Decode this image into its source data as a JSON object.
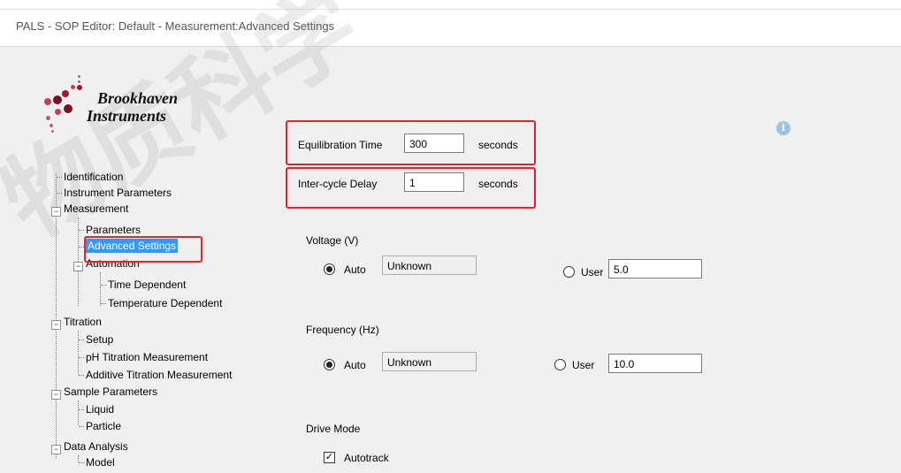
{
  "window": {
    "title": "PALS - SOP Editor: Default - Measurement:Advanced Settings"
  },
  "logo": {
    "line1": "Brookhaven",
    "line2": "Instruments"
  },
  "watermark": "物质科学",
  "tree": {
    "items": [
      {
        "label": "Identification"
      },
      {
        "label": "Instrument Parameters"
      },
      {
        "label": "Measurement",
        "expander": "−"
      },
      {
        "label": "Parameters"
      },
      {
        "label": "Advanced Settings"
      },
      {
        "label": "Automation",
        "expander": "−"
      },
      {
        "label": "Time Dependent"
      },
      {
        "label": "Temperature Dependent"
      },
      {
        "label": "Titration",
        "expander": "−"
      },
      {
        "label": "Setup"
      },
      {
        "label": "pH Titration Measurement"
      },
      {
        "label": "Additive Titration Measurement"
      },
      {
        "label": "Sample Parameters",
        "expander": "−"
      },
      {
        "label": "Liquid"
      },
      {
        "label": "Particle"
      },
      {
        "label": "Data Analysis",
        "expander": "−"
      },
      {
        "label": "Model"
      }
    ],
    "selected": "Advanced Settings"
  },
  "equilibration": {
    "label": "Equilibration Time",
    "value": "300",
    "unit": "seconds"
  },
  "intercycle": {
    "label": "Inter-cycle Delay",
    "value": "1",
    "unit": "seconds"
  },
  "voltage": {
    "title": "Voltage (V)",
    "auto_label": "Auto",
    "auto_value": "Unknown",
    "user_label": "User",
    "user_value": "5.0",
    "mode": "Auto"
  },
  "frequency": {
    "title": "Frequency (Hz)",
    "auto_label": "Auto",
    "auto_value": "Unknown",
    "user_label": "User",
    "user_value": "10.0",
    "mode": "Auto"
  },
  "drive_mode": {
    "title": "Drive Mode",
    "autotrack_label": "Autotrack",
    "autotrack_checked": true,
    "check_glyph": "✓"
  },
  "info_icon": {
    "icon": "info-icon",
    "glyph": "i"
  },
  "colors": {
    "highlight": "#e8222a",
    "selection": "#3399ff",
    "panel": "#f0f0f0"
  }
}
